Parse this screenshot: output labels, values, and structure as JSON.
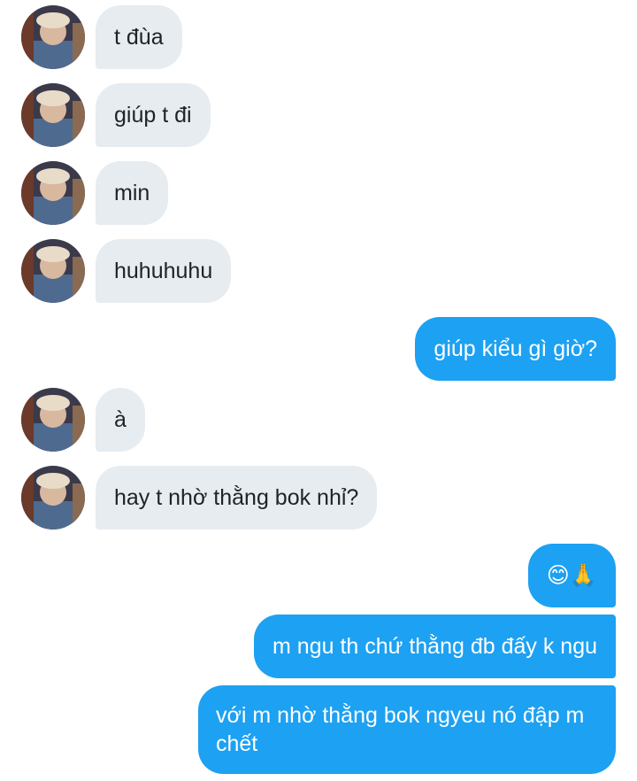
{
  "conversation": {
    "messages": [
      {
        "side": "in",
        "text": "t đùa",
        "avatar_icon": "contact-avatar"
      },
      {
        "side": "in",
        "text": "giúp t đi",
        "avatar_icon": "contact-avatar"
      },
      {
        "side": "in",
        "text": "min",
        "avatar_icon": "contact-avatar"
      },
      {
        "side": "in",
        "text": "huhuhuhu",
        "avatar_icon": "contact-avatar"
      },
      {
        "side": "out",
        "text": "giúp kiểu gì giờ?"
      },
      {
        "side": "in",
        "text": "à",
        "avatar_icon": "contact-avatar"
      },
      {
        "side": "in",
        "text": "hay t nhờ thằng bok nhỉ?",
        "avatar_icon": "contact-avatar"
      },
      {
        "side": "out",
        "text": "😊🙏"
      },
      {
        "side": "out",
        "text": "m ngu th chứ thằng đb đấy k ngu"
      },
      {
        "side": "out",
        "text": "với m nhờ thằng bok ngyeu nó đập m chết"
      }
    ]
  },
  "colors": {
    "incoming_bubble": "#e6ecf0",
    "outgoing_bubble": "#1da1f2",
    "incoming_text": "#1f2328",
    "outgoing_text": "#ffffff"
  }
}
